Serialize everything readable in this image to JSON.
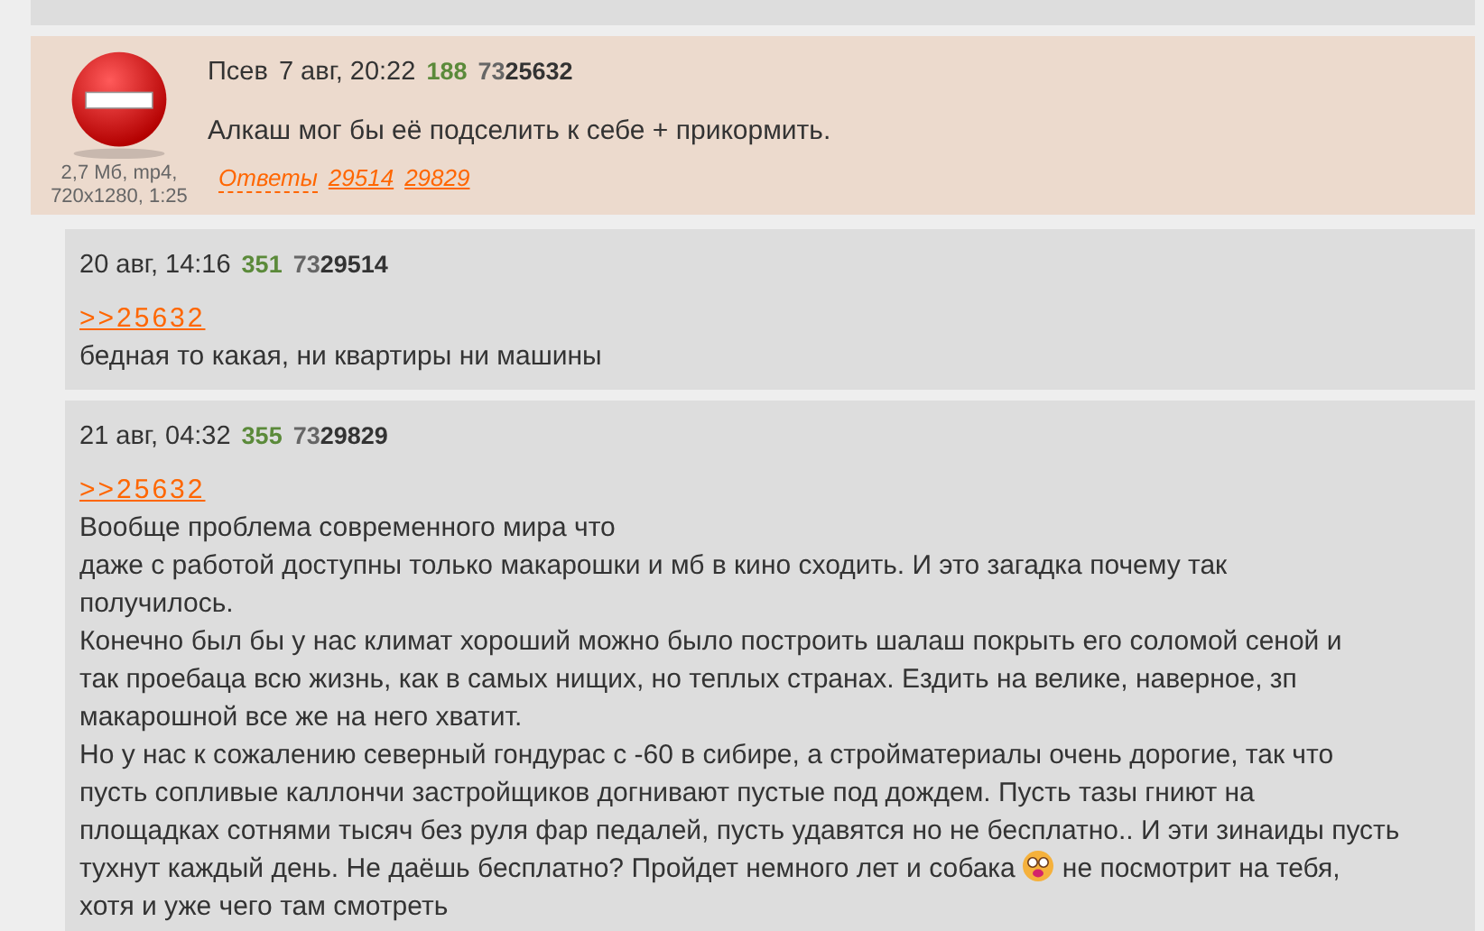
{
  "op_post": {
    "name": "Псев",
    "date": "7 авг, 20:22",
    "number": "188",
    "id_prefix": "73",
    "id_rest": "25632",
    "file_info": [
      "2,7 Мб, mp4,",
      "720x1280, 1:25"
    ],
    "text": "Алкаш мог бы её подселить к себе + прикормить.",
    "replies_label": "Ответы",
    "replies": [
      "29514",
      "29829"
    ]
  },
  "replies": [
    {
      "date": "20 авг, 14:16",
      "number": "351",
      "id_prefix": "73",
      "id_rest": "29514",
      "link": ">>25632",
      "lines": [
        [
          {
            "kind": "text",
            "text": "бедная то какая, ни квартиры ни машины"
          }
        ]
      ]
    },
    {
      "date": "21 авг, 04:32",
      "number": "355",
      "id_prefix": "73",
      "id_rest": "29829",
      "link": ">>25632",
      "lines": [
        [
          {
            "kind": "text",
            "text": "Вообще проблема современного мира что"
          }
        ],
        [
          {
            "kind": "text",
            "text": "даже с работой доступны только макарошки и мб в кино сходить. И это загадка почему так"
          }
        ],
        [
          {
            "kind": "text",
            "text": "получилось."
          }
        ],
        [
          {
            "kind": "text",
            "text": "Конечно был бы у нас климат хороший можно было построить шалаш покрыть его соломой сеной и"
          }
        ],
        [
          {
            "kind": "text",
            "text": "так проебаца всю жизнь, как в самых нищих, но теплых странах. Ездить на велике, наверное, зп"
          }
        ],
        [
          {
            "kind": "text",
            "text": "макарошной все же на него хватит."
          }
        ],
        [
          {
            "kind": "text",
            "text": "Но у нас к сожалению северный гондурас с -60 в сибире, а стройматериалы очень дорогие, так что"
          }
        ],
        [
          {
            "kind": "text",
            "text": "пусть сопливые каллончи застройщиков догнивают пустые под дождем. Пусть тазы гниют на"
          }
        ],
        [
          {
            "kind": "text",
            "text": "площадках сотнями тысяч без руля фар педалей, пусть удавятся но не бесплатно.. И эти зинаиды пусть"
          }
        ],
        [
          {
            "kind": "text",
            "text": "тухнут каждый день. Не даёшь бесплатно? Пройдет немного лет и собака"
          },
          {
            "kind": "emoji"
          },
          {
            "kind": "text",
            "text": "не посмотрит на тебя,"
          }
        ],
        [
          {
            "kind": "text",
            "text": "хотя и уже чего там смотреть"
          }
        ]
      ]
    }
  ]
}
